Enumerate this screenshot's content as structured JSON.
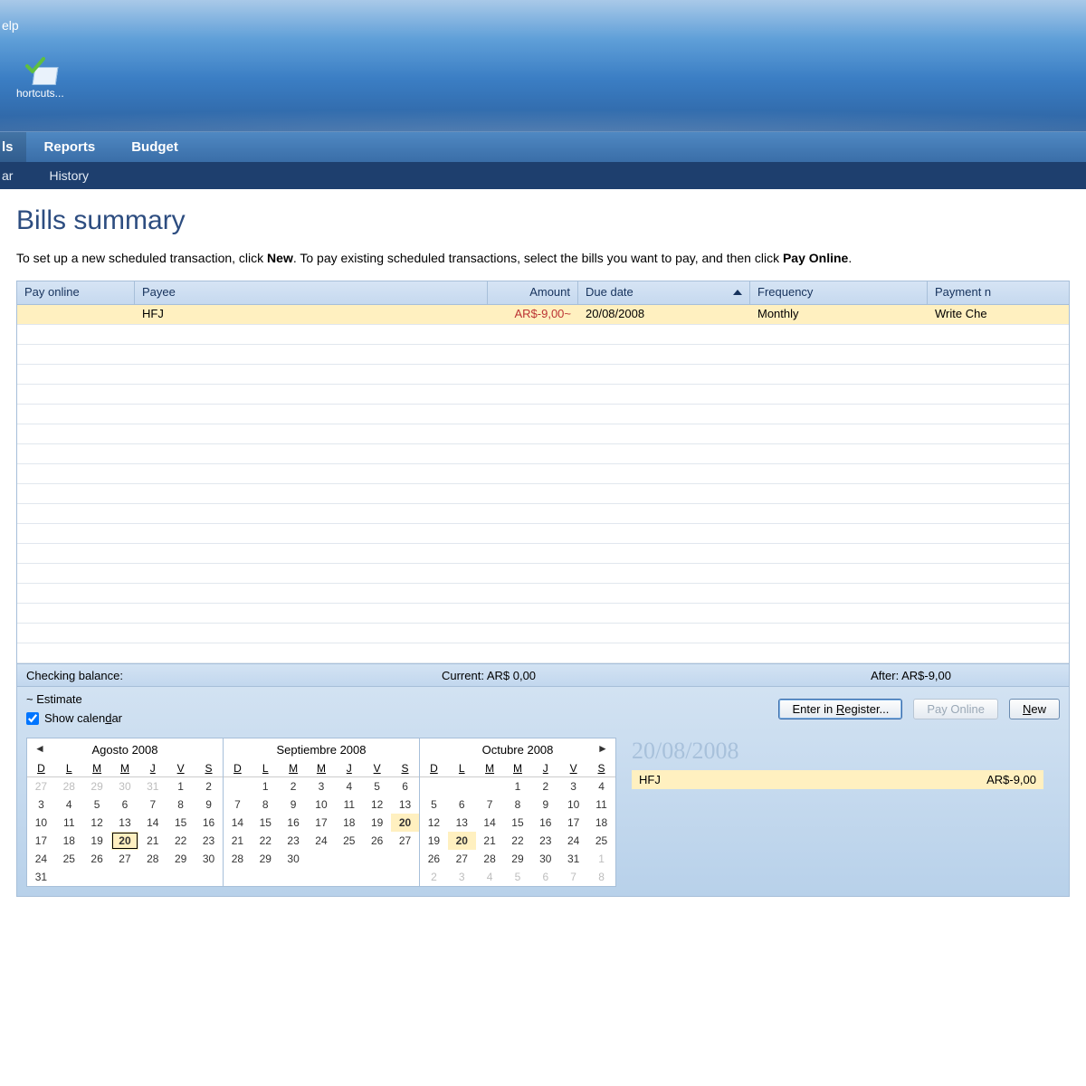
{
  "menubar": {
    "help": "elp"
  },
  "shortcut": {
    "label": "hortcuts..."
  },
  "nav1": {
    "bills": "ls",
    "reports": "Reports",
    "budget": "Budget"
  },
  "nav2": {
    "calendar": "ar",
    "history": "History"
  },
  "page": {
    "title": "Bills summary",
    "intro_1": "To set up a new scheduled transaction, click ",
    "intro_new": "New",
    "intro_2": ". To pay existing scheduled transactions, select the bills you want to pay, and then click ",
    "intro_pay": "Pay Online",
    "intro_3": "."
  },
  "grid": {
    "headers": {
      "pay_online": "Pay online",
      "payee": "Payee",
      "amount": "Amount",
      "due_date": "Due date",
      "frequency": "Frequency",
      "payment": "Payment n"
    },
    "rows": [
      {
        "pay_online": "",
        "payee": "HFJ",
        "amount": "AR$-9,00~",
        "due_date": "20/08/2008",
        "frequency": "Monthly",
        "payment": "Write Che"
      }
    ]
  },
  "balance": {
    "label": "Checking balance:",
    "current": "Current: AR$ 0,00",
    "after": "After: AR$-9,00"
  },
  "lower": {
    "estimate": "~ Estimate",
    "show_cal_pre": "Show calen",
    "show_cal_u": "d",
    "show_cal_post": "ar",
    "buttons": {
      "enter_pre": "Enter in ",
      "enter_u": "R",
      "enter_post": "egister...",
      "pay": "Pay Online",
      "new_u": "N",
      "new_post": "ew"
    }
  },
  "calendars": [
    {
      "title": "Agosto 2008",
      "nav_left": true,
      "nav_right": false,
      "dow": [
        "D",
        "L",
        "M",
        "M",
        "J",
        "V",
        "S"
      ],
      "weeks": [
        [
          {
            "d": 27,
            "dim": true
          },
          {
            "d": 28,
            "dim": true
          },
          {
            "d": 29,
            "dim": true
          },
          {
            "d": 30,
            "dim": true
          },
          {
            "d": 31,
            "dim": true
          },
          {
            "d": 1
          },
          {
            "d": 2
          }
        ],
        [
          {
            "d": 3
          },
          {
            "d": 4
          },
          {
            "d": 5
          },
          {
            "d": 6
          },
          {
            "d": 7
          },
          {
            "d": 8
          },
          {
            "d": 9
          }
        ],
        [
          {
            "d": 10
          },
          {
            "d": 11
          },
          {
            "d": 12
          },
          {
            "d": 13
          },
          {
            "d": 14
          },
          {
            "d": 15
          },
          {
            "d": 16
          }
        ],
        [
          {
            "d": 17
          },
          {
            "d": 18
          },
          {
            "d": 19
          },
          {
            "d": 20,
            "today": true,
            "mark": true
          },
          {
            "d": 21
          },
          {
            "d": 22
          },
          {
            "d": 23
          }
        ],
        [
          {
            "d": 24
          },
          {
            "d": 25
          },
          {
            "d": 26
          },
          {
            "d": 27
          },
          {
            "d": 28
          },
          {
            "d": 29
          },
          {
            "d": 30
          }
        ],
        [
          {
            "d": 31
          },
          {
            "d": ""
          },
          {
            "d": ""
          },
          {
            "d": ""
          },
          {
            "d": ""
          },
          {
            "d": ""
          },
          {
            "d": ""
          }
        ]
      ]
    },
    {
      "title": "Septiembre 2008",
      "nav_left": false,
      "nav_right": false,
      "dow": [
        "D",
        "L",
        "M",
        "M",
        "J",
        "V",
        "S"
      ],
      "weeks": [
        [
          {
            "d": ""
          },
          {
            "d": 1
          },
          {
            "d": 2
          },
          {
            "d": 3
          },
          {
            "d": 4
          },
          {
            "d": 5
          },
          {
            "d": 6
          }
        ],
        [
          {
            "d": 7
          },
          {
            "d": 8
          },
          {
            "d": 9
          },
          {
            "d": 10
          },
          {
            "d": 11
          },
          {
            "d": 12
          },
          {
            "d": 13
          }
        ],
        [
          {
            "d": 14
          },
          {
            "d": 15
          },
          {
            "d": 16
          },
          {
            "d": 17
          },
          {
            "d": 18
          },
          {
            "d": 19
          },
          {
            "d": 20,
            "mark": true
          }
        ],
        [
          {
            "d": 21
          },
          {
            "d": 22
          },
          {
            "d": 23
          },
          {
            "d": 24
          },
          {
            "d": 25
          },
          {
            "d": 26
          },
          {
            "d": 27
          }
        ],
        [
          {
            "d": 28
          },
          {
            "d": 29
          },
          {
            "d": 30
          },
          {
            "d": ""
          },
          {
            "d": ""
          },
          {
            "d": ""
          },
          {
            "d": ""
          }
        ]
      ]
    },
    {
      "title": "Octubre 2008",
      "nav_left": false,
      "nav_right": true,
      "dow": [
        "D",
        "L",
        "M",
        "M",
        "J",
        "V",
        "S"
      ],
      "weeks": [
        [
          {
            "d": ""
          },
          {
            "d": ""
          },
          {
            "d": ""
          },
          {
            "d": 1
          },
          {
            "d": 2
          },
          {
            "d": 3
          },
          {
            "d": 4
          }
        ],
        [
          {
            "d": 5
          },
          {
            "d": 6
          },
          {
            "d": 7
          },
          {
            "d": 8
          },
          {
            "d": 9
          },
          {
            "d": 10
          },
          {
            "d": 11
          }
        ],
        [
          {
            "d": 12
          },
          {
            "d": 13
          },
          {
            "d": 14
          },
          {
            "d": 15
          },
          {
            "d": 16
          },
          {
            "d": 17
          },
          {
            "d": 18
          }
        ],
        [
          {
            "d": 19
          },
          {
            "d": 20,
            "mark": true
          },
          {
            "d": 21
          },
          {
            "d": 22
          },
          {
            "d": 23
          },
          {
            "d": 24
          },
          {
            "d": 25
          }
        ],
        [
          {
            "d": 26
          },
          {
            "d": 27
          },
          {
            "d": 28
          },
          {
            "d": 29
          },
          {
            "d": 30
          },
          {
            "d": 31
          },
          {
            "d": 1,
            "dim": true
          }
        ],
        [
          {
            "d": 2,
            "dim": true
          },
          {
            "d": 3,
            "dim": true
          },
          {
            "d": 4,
            "dim": true
          },
          {
            "d": 5,
            "dim": true
          },
          {
            "d": 6,
            "dim": true
          },
          {
            "d": 7,
            "dim": true
          },
          {
            "d": 8,
            "dim": true
          }
        ]
      ]
    }
  ],
  "detail": {
    "date": "20/08/2008",
    "items": [
      {
        "name": "HFJ",
        "amount": "AR$-9,00"
      }
    ]
  }
}
